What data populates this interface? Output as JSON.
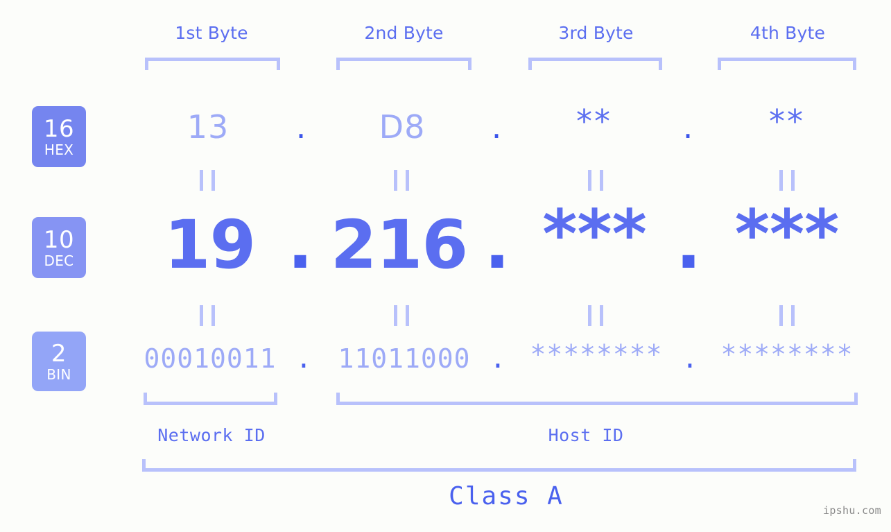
{
  "meta": {
    "background_color": "#fcfdfa",
    "accent_color": "#5b6ef0",
    "accent_light_color": "#9daaf7",
    "bracket_color": "#b8c1fb",
    "dot_color": "#4a61ee",
    "watermark": "ipshu.com"
  },
  "byte_headers": [
    {
      "label": "1st Byte"
    },
    {
      "label": "2nd Byte"
    },
    {
      "label": "3rd Byte"
    },
    {
      "label": "4th Byte"
    }
  ],
  "bases": [
    {
      "number": "16",
      "name": "HEX",
      "color": "#7585ef"
    },
    {
      "number": "10",
      "name": "DEC",
      "color": "#8694f3"
    },
    {
      "number": "2",
      "name": "BIN",
      "color": "#93a5f7"
    }
  ],
  "rows": {
    "hex": {
      "base_number": "16",
      "base_name": "HEX",
      "values": [
        "13",
        "D8",
        "**",
        "**"
      ],
      "masked": [
        false,
        false,
        true,
        true
      ],
      "separators": [
        ".",
        ".",
        "."
      ]
    },
    "dec": {
      "base_number": "10",
      "base_name": "DEC",
      "values": [
        "19",
        "216",
        "***",
        "***"
      ],
      "masked": [
        false,
        false,
        true,
        true
      ],
      "separators": [
        ".",
        ".",
        "."
      ]
    },
    "bin": {
      "base_number": "2",
      "base_name": "BIN",
      "values": [
        "00010011",
        "11011000",
        "********",
        "********"
      ],
      "masked": [
        false,
        false,
        true,
        true
      ],
      "separators": [
        ".",
        ".",
        "."
      ]
    }
  },
  "equals_marks": [
    "||",
    "||",
    "||",
    "||",
    "||",
    "||",
    "||",
    "||"
  ],
  "segments": {
    "network_id": "Network ID",
    "host_id": "Host ID",
    "class": "Class A"
  },
  "ip_address": {
    "hex": "13.D8.**.**",
    "dec": "19.216.***.***",
    "bin": "00010011.11011000.********.********"
  }
}
